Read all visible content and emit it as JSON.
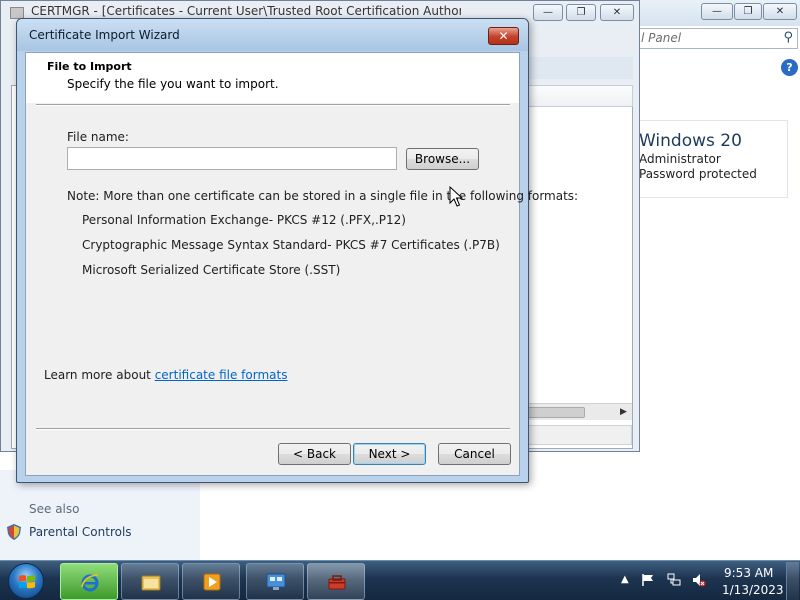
{
  "background_window": {
    "search_placeholder": "l Panel",
    "help_label": "?",
    "system_info": {
      "title": "Windows 20",
      "line1": "Administrator",
      "line2": "Password protected"
    },
    "see_also": "See also",
    "parental_controls": "Parental Controls"
  },
  "console_window": {
    "title": "CERTMGR - [Certificates - Current User\\Trusted Root Certification Authorities]"
  },
  "wizard": {
    "title": "Certificate Import Wizard",
    "close_label": "✕",
    "header_title": "File to Import",
    "header_subtitle": "Specify the file you want to import.",
    "file_label": "File name:",
    "file_value": "",
    "browse_label": "Browse...",
    "note": "Note:  More than one certificate can be stored in a single file in the following formats:",
    "formats": [
      "Personal Information Exchange- PKCS #12 (.PFX,.P12)",
      "Cryptographic Message Syntax Standard- PKCS #7 Certificates (.P7B)",
      "Microsoft Serialized Certificate Store (.SST)"
    ],
    "learn_prefix": "Learn more about ",
    "learn_link": "certificate file formats",
    "back_label": "< Back",
    "next_label": "Next >",
    "cancel_label": "Cancel"
  },
  "taskbar": {
    "time": "9:53 AM",
    "date": "1/13/2023"
  },
  "colors": {
    "link": "#0066cc",
    "title_bar": "#b9d1ea",
    "close_button": "#c4412a",
    "taskbar": "#1d3450"
  }
}
